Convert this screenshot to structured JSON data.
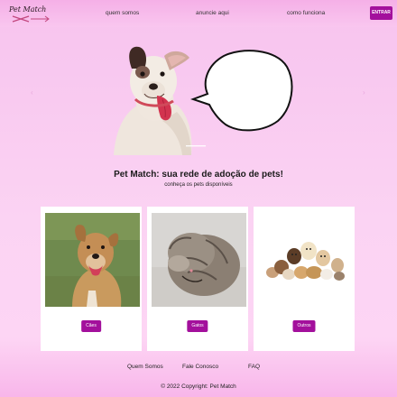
{
  "brand": {
    "logo_text": "Pet Match",
    "accent_color": "#a3109c",
    "background_color": "#f9c8f0"
  },
  "nav": {
    "links": [
      "quem somos",
      "anuncie aqui",
      "como funciona"
    ],
    "enter_button": "ENTRAR"
  },
  "hero": {
    "carousel_prev_icon": "chevron-left-icon",
    "carousel_next_icon": "chevron-right-icon",
    "image_subject": "dog with speech bubble"
  },
  "main": {
    "headline": "Pet Match: sua rede de adoção de pets!",
    "subheadline": "conheça os pets disponíveis"
  },
  "cards": [
    {
      "button": "Cães",
      "image_subject": "dog"
    },
    {
      "button": "Gatos",
      "image_subject": "cat"
    },
    {
      "button": "Outros",
      "image_subject": "group of pets"
    }
  ],
  "footer": {
    "links": [
      "Quem Somos",
      "Fale Conosco",
      "FAQ"
    ],
    "copyright": "© 2022 Copyright: Pet Match"
  }
}
